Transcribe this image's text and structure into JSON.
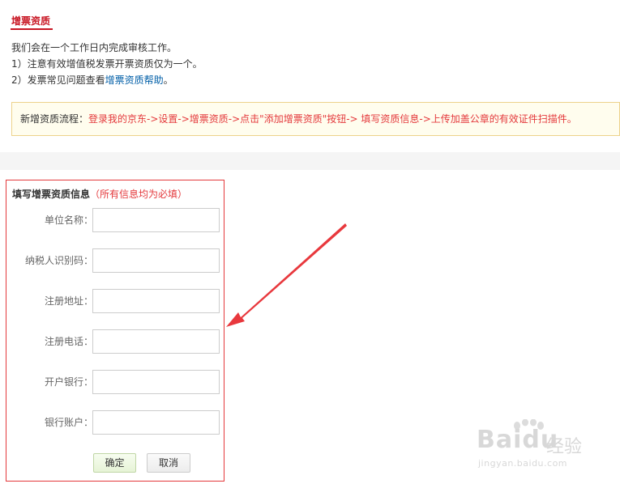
{
  "header": {
    "title": "增票资质"
  },
  "info": {
    "line1": "我们会在一个工作日内完成审核工作。",
    "line2": "1）注意有效增值税发票开票资质仅为一个。",
    "line3_prefix": "2）发票常见问题查看",
    "line3_link": "增票资质帮助",
    "line3_suffix": "。"
  },
  "flow": {
    "label": "新增资质流程：",
    "steps": "登录我的京东->设置->增票资质->点击\"添加增票资质\"按钮-> 填写资质信息->上传加盖公章的有效证件扫描件。"
  },
  "form": {
    "heading": "填写增票资质信息",
    "note": "（所有信息均为必填）",
    "fields": [
      {
        "label": "单位名称：",
        "value": ""
      },
      {
        "label": "纳税人识别码：",
        "value": ""
      },
      {
        "label": "注册地址：",
        "value": ""
      },
      {
        "label": "注册电话：",
        "value": ""
      },
      {
        "label": "开户银行：",
        "value": ""
      },
      {
        "label": "银行账户：",
        "value": ""
      }
    ],
    "confirm_label": "确定",
    "cancel_label": "取消"
  },
  "annotation": {
    "arrow_color": "#e8383d"
  },
  "watermark": {
    "main": "Baidu",
    "cn": "经验",
    "url": "jingyan.baidu.com"
  }
}
